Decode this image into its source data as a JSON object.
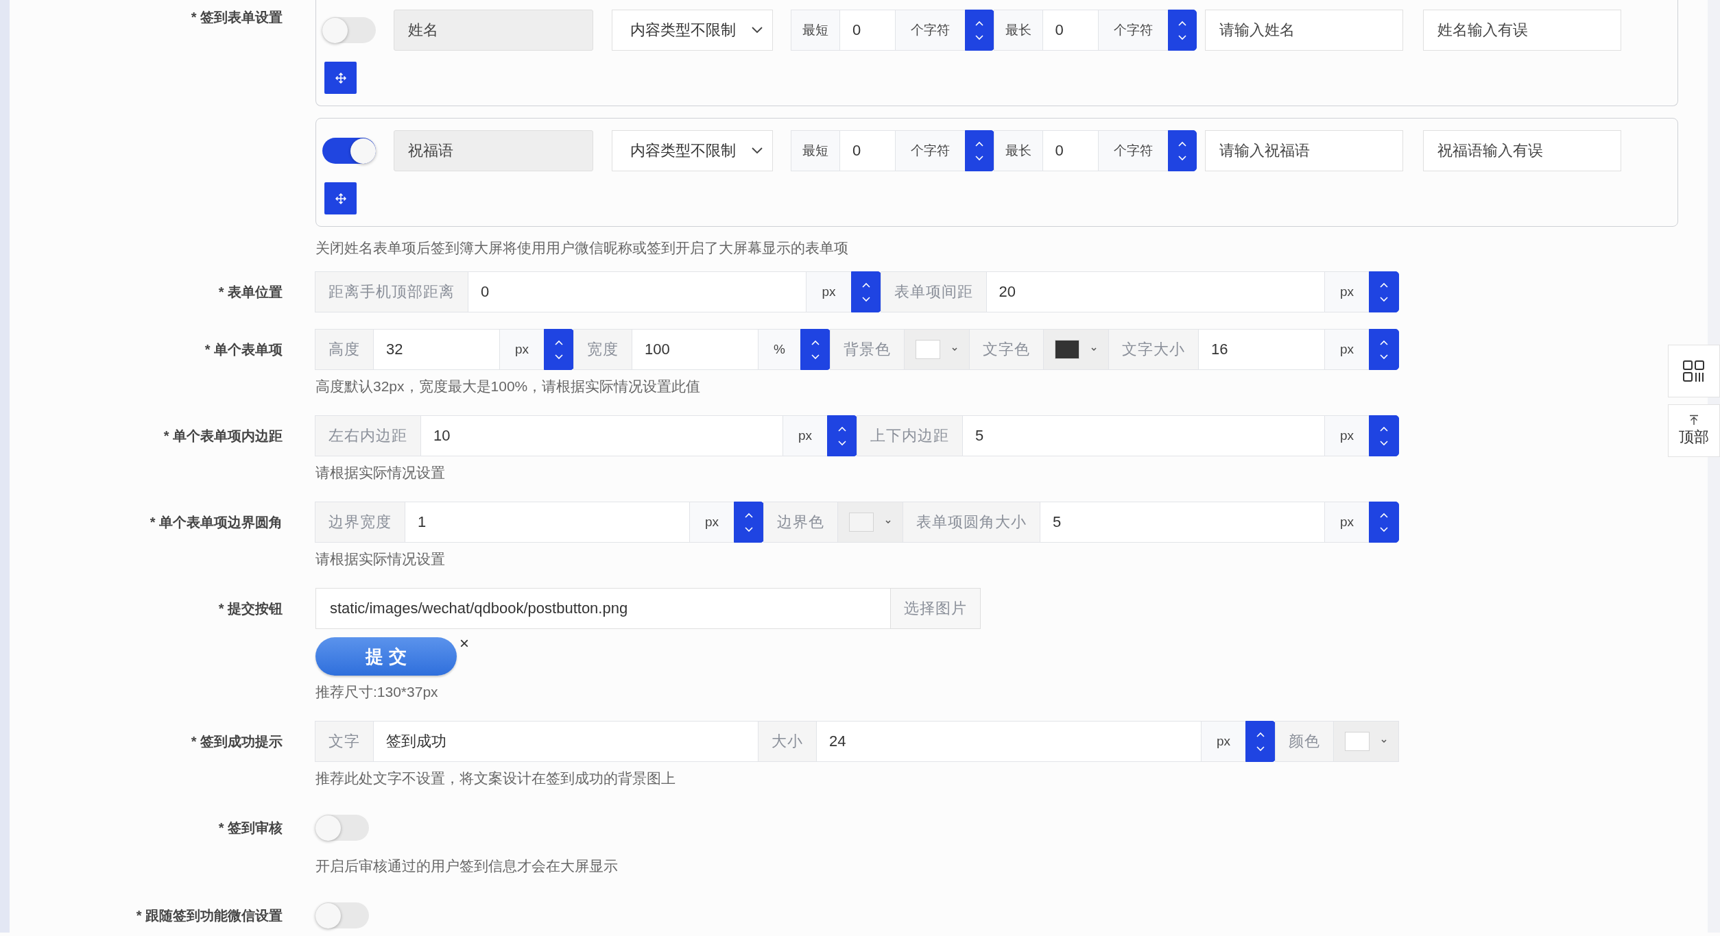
{
  "form_items": {
    "label": "* 签到表单设置",
    "items": [
      {
        "enabled": false,
        "name": "姓名",
        "content_type": "内容类型不限制",
        "limits": [
          {
            "kind": "addon",
            "text": "最短"
          },
          {
            "kind": "input",
            "value": "0"
          },
          {
            "kind": "unit",
            "text": "个字符"
          },
          {
            "kind": "spinner"
          },
          {
            "kind": "addon",
            "text": "最长"
          },
          {
            "kind": "input",
            "value": "0"
          },
          {
            "kind": "unit",
            "text": "个字符"
          },
          {
            "kind": "spinner"
          }
        ],
        "prompt": "请输入姓名",
        "error_message": "姓名输入有误"
      },
      {
        "enabled": true,
        "name": "祝福语",
        "content_type": "内容类型不限制",
        "limits": [
          {
            "kind": "addon",
            "text": "最短"
          },
          {
            "kind": "input",
            "value": "0"
          },
          {
            "kind": "unit",
            "text": "个字符"
          },
          {
            "kind": "spinner"
          },
          {
            "kind": "addon",
            "text": "最长"
          },
          {
            "kind": "input",
            "value": "0"
          },
          {
            "kind": "unit",
            "text": "个字符"
          },
          {
            "kind": "spinner"
          }
        ],
        "prompt": "请输入祝福语",
        "error_message": "祝福语输入有误"
      }
    ],
    "hint": "关闭姓名表单项后签到簿大屏将使用用户微信昵称或签到开启了大屏幕显示的表单项"
  },
  "rows": [
    {
      "kind": "group",
      "label": "* 表单位置",
      "parts": [
        {
          "kind": "addon",
          "text": "距离手机顶部距离"
        },
        {
          "kind": "input",
          "value": "0"
        },
        {
          "kind": "unit",
          "text": "px"
        },
        {
          "kind": "spinner"
        },
        {
          "kind": "addon",
          "text": "表单项间距"
        },
        {
          "kind": "input",
          "value": "20"
        },
        {
          "kind": "unit",
          "text": "px"
        },
        {
          "kind": "spinner"
        }
      ]
    },
    {
      "kind": "group",
      "label": "* 单个表单项",
      "parts": [
        {
          "kind": "addon",
          "text": "高度"
        },
        {
          "kind": "input",
          "value": "32"
        },
        {
          "kind": "unit",
          "text": "px"
        },
        {
          "kind": "spinner"
        },
        {
          "kind": "addon",
          "text": "宽度"
        },
        {
          "kind": "input",
          "value": "100"
        },
        {
          "kind": "unit",
          "text": "%"
        },
        {
          "kind": "spinner"
        },
        {
          "kind": "addon",
          "text": "背景色"
        },
        {
          "kind": "color",
          "color": "#ffffff"
        },
        {
          "kind": "addon",
          "text": "文字色"
        },
        {
          "kind": "color",
          "color": "#333333"
        },
        {
          "kind": "addon",
          "text": "文字大小"
        },
        {
          "kind": "input",
          "value": "16"
        },
        {
          "kind": "unit",
          "text": "px"
        },
        {
          "kind": "spinner"
        }
      ],
      "hint": "高度默认32px，宽度最大是100%，请根据实际情况设置此值"
    },
    {
      "kind": "group",
      "label": "* 单个表单项内边距",
      "parts": [
        {
          "kind": "addon",
          "text": "左右内边距"
        },
        {
          "kind": "input",
          "value": "10"
        },
        {
          "kind": "unit",
          "text": "px"
        },
        {
          "kind": "spinner"
        },
        {
          "kind": "addon",
          "text": "上下内边距"
        },
        {
          "kind": "input",
          "value": "5"
        },
        {
          "kind": "unit",
          "text": "px"
        },
        {
          "kind": "spinner"
        }
      ],
      "hint": "请根据实际情况设置"
    },
    {
      "kind": "group",
      "label": "* 单个表单项边界圆角",
      "parts": [
        {
          "kind": "addon",
          "text": "边界宽度"
        },
        {
          "kind": "input",
          "value": "1"
        },
        {
          "kind": "unit",
          "text": "px"
        },
        {
          "kind": "spinner"
        },
        {
          "kind": "addon",
          "text": "边界色"
        },
        {
          "kind": "color",
          "color": "#f4f4f4"
        },
        {
          "kind": "addon",
          "text": "表单项圆角大小"
        },
        {
          "kind": "input",
          "value": "5"
        },
        {
          "kind": "unit",
          "text": "px"
        },
        {
          "kind": "spinner"
        }
      ],
      "hint": "请根据实际情况设置"
    },
    {
      "kind": "file",
      "label": "* 提交按钮",
      "value": "static/images/wechat/qdbook/postbutton.png",
      "button": "选择图片",
      "preview": "提 交",
      "remove": "×",
      "hint": "推荐尺寸:130*37px"
    },
    {
      "kind": "group",
      "label": "* 签到成功提示",
      "parts": [
        {
          "kind": "addon",
          "text": "文字"
        },
        {
          "kind": "input",
          "value": "签到成功"
        },
        {
          "kind": "addon",
          "text": "大小"
        },
        {
          "kind": "input",
          "value": "24"
        },
        {
          "kind": "unit",
          "text": "px"
        },
        {
          "kind": "spinner"
        },
        {
          "kind": "addon",
          "text": "颜色"
        },
        {
          "kind": "color",
          "color": "#ffffff"
        }
      ],
      "hint": "推荐此处文字不设置，将文案设计在签到成功的背景图上"
    },
    {
      "kind": "toggle",
      "label": "* 签到审核",
      "on": false,
      "hint": "开启后审核通过的用户签到信息才会在大屏显示"
    },
    {
      "kind": "toggle",
      "label": "* 跟随签到功能微信设置",
      "on": false
    }
  ],
  "float_panel": {
    "top_label": "顶部"
  }
}
